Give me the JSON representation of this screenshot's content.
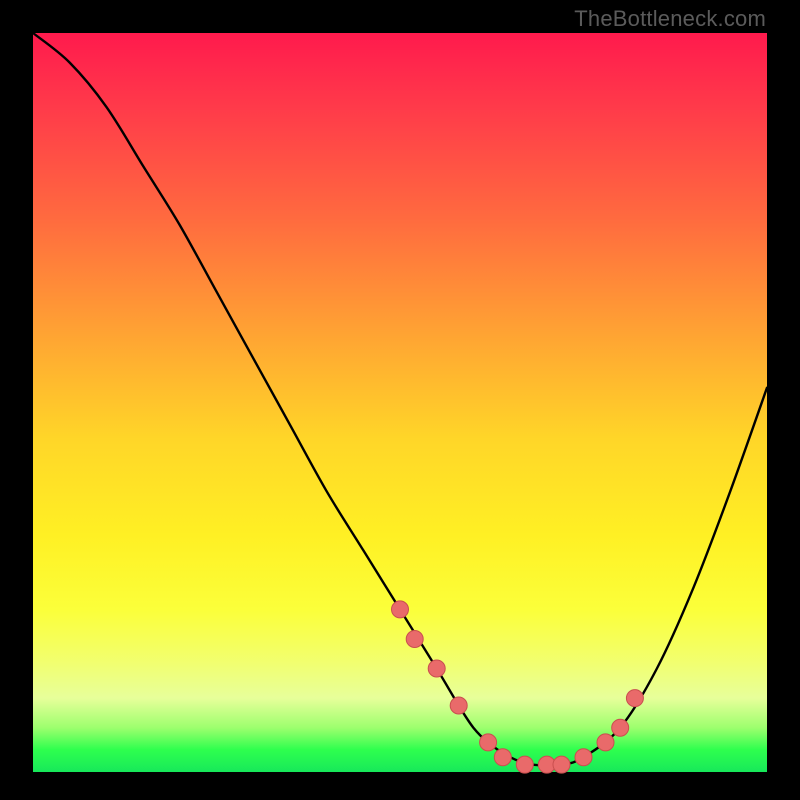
{
  "watermark": "TheBottleneck.com",
  "colors": {
    "background": "#000000",
    "gradient_top": "#ff1a4d",
    "gradient_bottom": "#17e85a",
    "curve_stroke": "#000000",
    "dot_fill": "#e96a6a",
    "dot_stroke": "#c94f4f"
  },
  "chart_data": {
    "type": "line",
    "title": "",
    "xlabel": "",
    "ylabel": "",
    "xlim": [
      0,
      100
    ],
    "ylim": [
      0,
      100
    ],
    "grid": false,
    "legend": false,
    "series": [
      {
        "name": "bottleneck-curve",
        "x": [
          0,
          5,
          10,
          15,
          20,
          25,
          30,
          35,
          40,
          45,
          50,
          55,
          58,
          60,
          62,
          65,
          68,
          72,
          75,
          80,
          85,
          90,
          95,
          100
        ],
        "y": [
          100,
          96,
          90,
          82,
          74,
          65,
          56,
          47,
          38,
          30,
          22,
          14,
          9,
          6,
          4,
          2,
          1,
          1,
          2,
          6,
          14,
          25,
          38,
          52
        ]
      }
    ],
    "markers": {
      "name": "highlighted-points",
      "x": [
        50,
        52,
        55,
        58,
        62,
        64,
        67,
        70,
        72,
        75,
        78,
        80,
        82
      ],
      "y": [
        22,
        18,
        14,
        9,
        4,
        2,
        1,
        1,
        1,
        2,
        4,
        6,
        10
      ]
    }
  }
}
